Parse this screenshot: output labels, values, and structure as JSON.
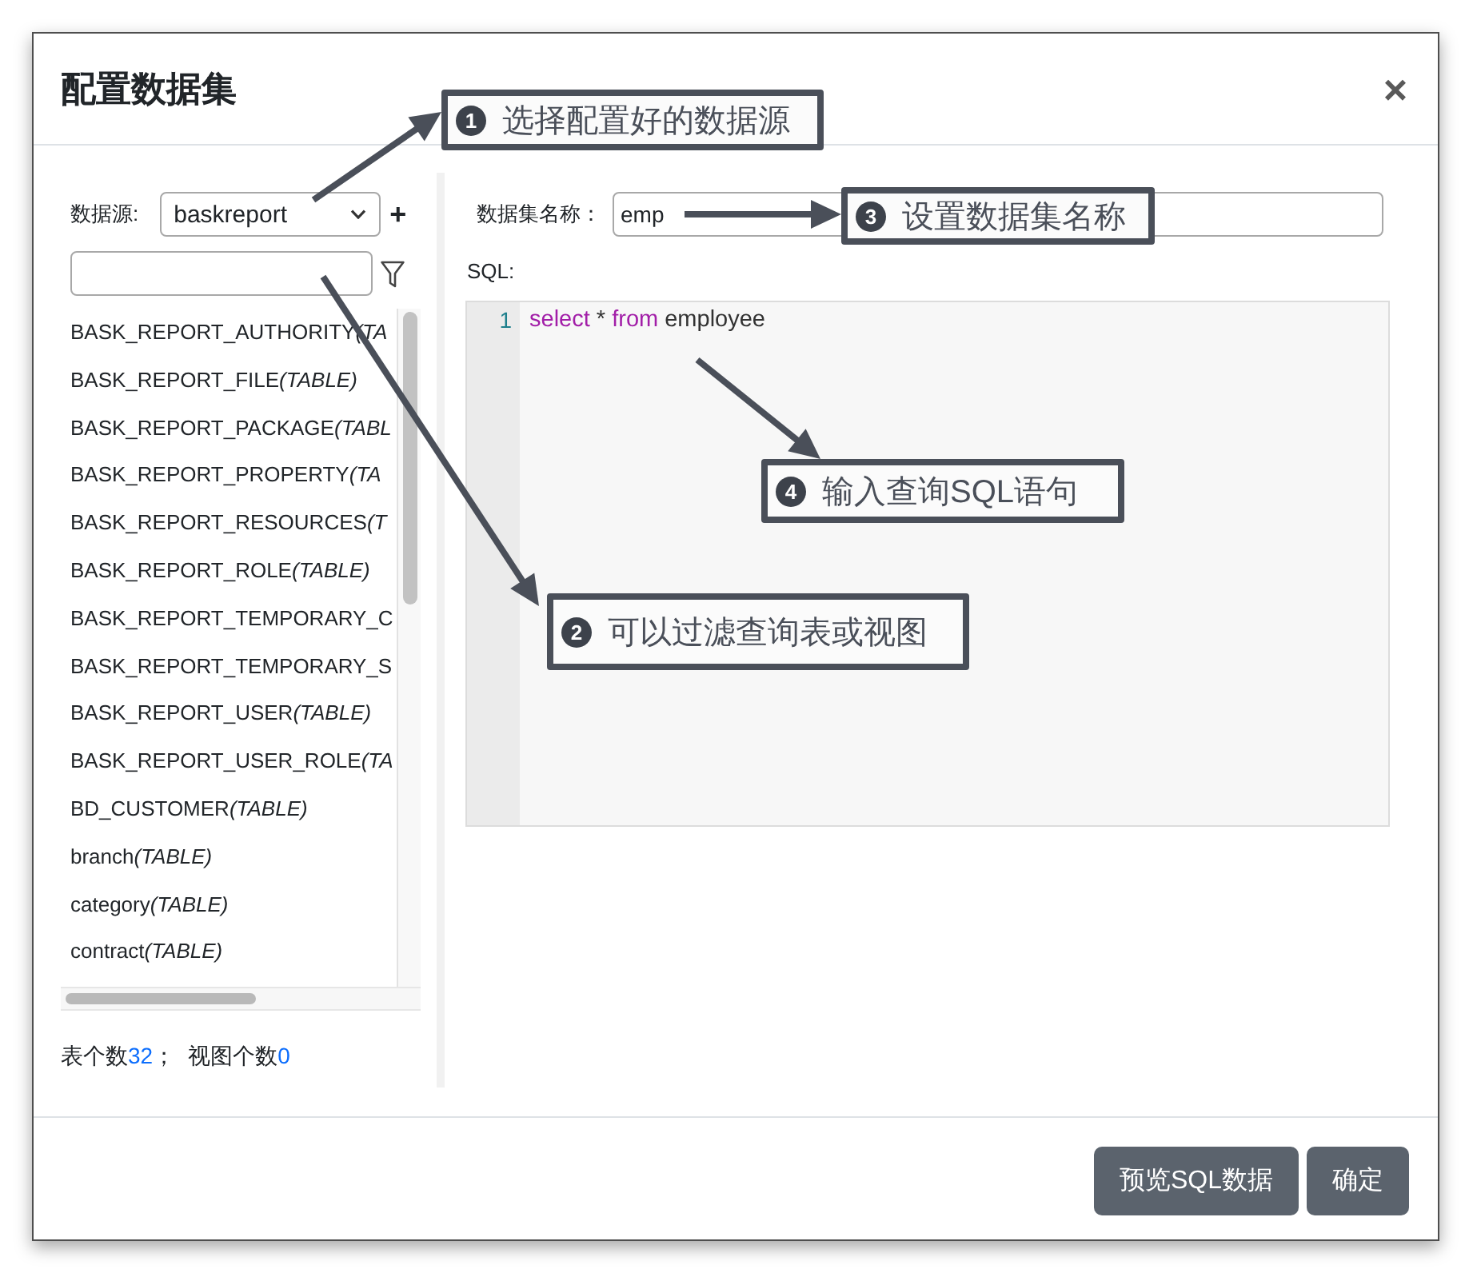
{
  "dialog": {
    "title": "配置数据集",
    "close": "×"
  },
  "data_source": {
    "label": "数据源:",
    "value": "baskreport",
    "add": "+"
  },
  "tables": [
    {
      "name": "BASK_REPORT_AUTHORITY",
      "type": "(TA"
    },
    {
      "name": "BASK_REPORT_FILE",
      "type": "(TABLE)"
    },
    {
      "name": "BASK_REPORT_PACKAGE",
      "type": "(TABL"
    },
    {
      "name": "BASK_REPORT_PROPERTY",
      "type": "(TA"
    },
    {
      "name": "BASK_REPORT_RESOURCES",
      "type": "(T"
    },
    {
      "name": "BASK_REPORT_ROLE",
      "type": "(TABLE)"
    },
    {
      "name": "BASK_REPORT_TEMPORARY_C"
    },
    {
      "name": "BASK_REPORT_TEMPORARY_S"
    },
    {
      "name": "BASK_REPORT_USER",
      "type": "(TABLE)"
    },
    {
      "name": "BASK_REPORT_USER_ROLE",
      "type": "(TA"
    },
    {
      "name": "BD_CUSTOMER",
      "type": "(TABLE)"
    },
    {
      "name": "branch",
      "type": "(TABLE)"
    },
    {
      "name": "category",
      "type": "(TABLE)"
    },
    {
      "name": "contract",
      "type": "(TABLE)"
    }
  ],
  "summary": [
    {
      "label": "表个数",
      "value": "32",
      "suffix": "；"
    },
    {
      "label": "视图个数",
      "value": "0"
    }
  ],
  "dataset_name": {
    "label": "数据集名称：",
    "value": "emp"
  },
  "sql": {
    "label": "SQL:",
    "lines": [
      {
        "number": "1",
        "tokens": [
          {
            "kind": "keyword",
            "text": "select"
          },
          {
            "kind": "plain",
            "text": " * "
          },
          {
            "kind": "keyword",
            "text": "from"
          },
          {
            "kind": "plain",
            "text": " employee"
          }
        ]
      }
    ]
  },
  "buttons": [
    "预览SQL数据",
    "确定"
  ],
  "annotations": [
    {
      "number": "1",
      "text": "选择配置好的数据源"
    },
    {
      "number": "2",
      "text": "可以过滤查询表或视图"
    },
    {
      "number": "3",
      "text": "设置数据集名称"
    },
    {
      "number": "4",
      "text": "输入查询SQL语句"
    }
  ]
}
